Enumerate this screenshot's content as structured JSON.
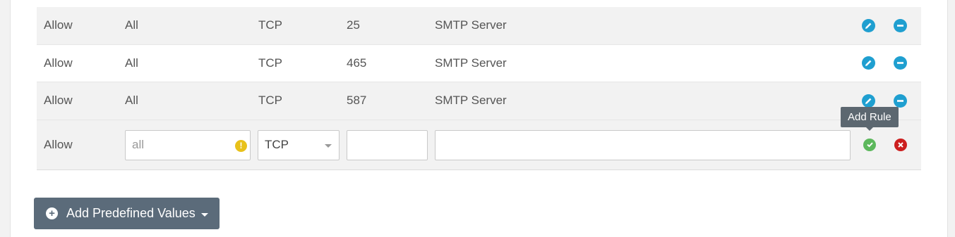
{
  "rules": [
    {
      "action": "Allow",
      "source": "All",
      "protocol": "TCP",
      "port": "25",
      "description": "SMTP Server"
    },
    {
      "action": "Allow",
      "source": "All",
      "protocol": "TCP",
      "port": "465",
      "description": "SMTP Server"
    },
    {
      "action": "Allow",
      "source": "All",
      "protocol": "TCP",
      "port": "587",
      "description": "SMTP Server"
    }
  ],
  "new_rule": {
    "action": "Allow",
    "source_placeholder": "all",
    "protocol_value": "TCP",
    "port_value": "",
    "description_value": ""
  },
  "tooltip": "Add Rule",
  "add_predefined_label": "Add Predefined Values",
  "icons": {
    "edit": "pencil-icon",
    "remove": "minus-circle-icon",
    "confirm": "check-circle-icon",
    "cancel": "x-circle-icon",
    "warning": "warning-icon",
    "add": "plus-circle-icon"
  },
  "colors": {
    "accent": "#1f9fd0",
    "confirm": "#5cb85c",
    "cancel": "#cc1f1f",
    "warning": "#e8c11a",
    "button": "#5b6b7a"
  }
}
